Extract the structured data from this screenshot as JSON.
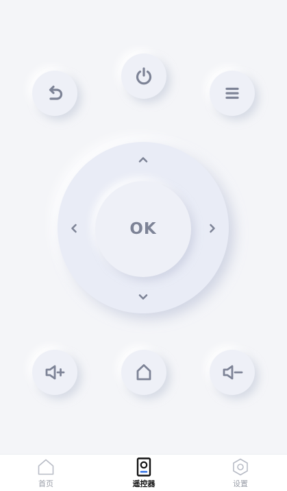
{
  "colors": {
    "icon": "#7d8396",
    "active_tab": "#111111",
    "inactive_tab": "#b8bcc6",
    "accent": "#2f6fe4"
  },
  "remote": {
    "buttons": [
      {
        "name": "back",
        "icon": "back-arrow-icon"
      },
      {
        "name": "power",
        "icon": "power-icon"
      },
      {
        "name": "menu",
        "icon": "menu-icon"
      },
      {
        "name": "volume-up",
        "icon": "volume-up-icon"
      },
      {
        "name": "home",
        "icon": "home-icon"
      },
      {
        "name": "volume-down",
        "icon": "volume-down-icon"
      }
    ],
    "dpad": {
      "ok_label": "OK"
    }
  },
  "tabbar": {
    "tabs": [
      {
        "label": "首页",
        "icon": "home-outline-icon",
        "active": false
      },
      {
        "label": "遥控器",
        "icon": "remote-icon",
        "active": true
      },
      {
        "label": "设置",
        "icon": "settings-hex-icon",
        "active": false
      }
    ]
  }
}
